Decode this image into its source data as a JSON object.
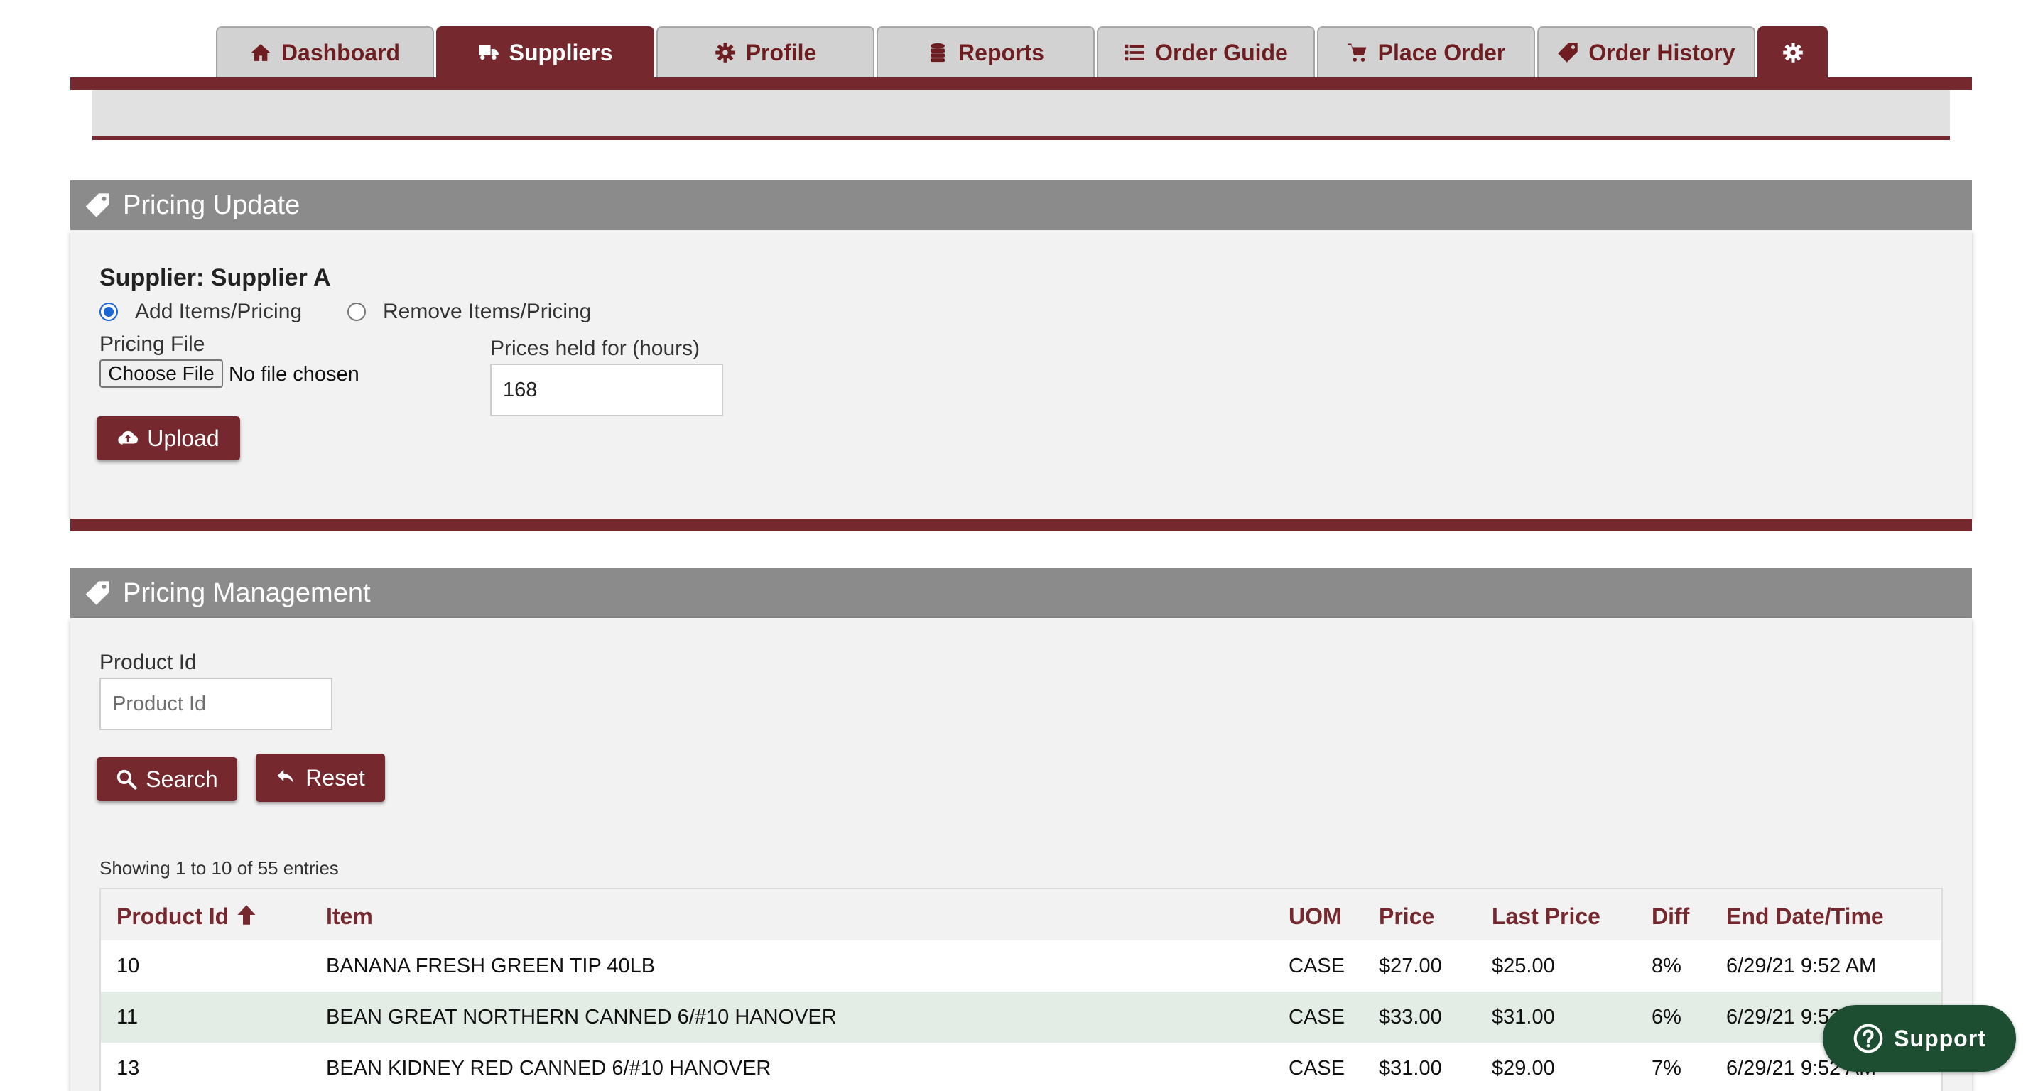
{
  "nav": {
    "tabs": [
      {
        "label": "Dashboard",
        "icon": "home-icon"
      },
      {
        "label": "Suppliers",
        "icon": "truck-icon",
        "active": true
      },
      {
        "label": "Profile",
        "icon": "gear-icon"
      },
      {
        "label": "Reports",
        "icon": "database-icon"
      },
      {
        "label": "Order Guide",
        "icon": "list-icon"
      },
      {
        "label": "Place Order",
        "icon": "cart-icon"
      },
      {
        "label": "Order History",
        "icon": "tag-icon"
      }
    ],
    "settings_icon": "gear-icon"
  },
  "pricing_update": {
    "title": "Pricing Update",
    "supplier_label": "Supplier: Supplier A",
    "radio_add": {
      "label": "Add Items/Pricing",
      "checked": true
    },
    "radio_remove": {
      "label": "Remove Items/Pricing",
      "checked": false
    },
    "file_label": "Pricing File",
    "file_button": "Choose File",
    "file_status": "No file chosen",
    "hours_label": "Prices held for (hours)",
    "hours_value": "168",
    "upload_button": "Upload"
  },
  "pricing_management": {
    "title": "Pricing Management",
    "product_id_label": "Product Id",
    "product_id_placeholder": "Product Id",
    "search_button": "Search",
    "reset_button": "Reset",
    "entries_info": "Showing 1 to 10 of 55 entries",
    "columns": [
      "Product Id",
      "Item",
      "UOM",
      "Price",
      "Last Price",
      "Diff",
      "End Date/Time"
    ],
    "rows": [
      {
        "product_id": "10",
        "item": "BANANA FRESH GREEN TIP 40LB",
        "uom": "CASE",
        "price": "$27.00",
        "last_price": "$25.00",
        "diff": "8%",
        "end": "6/29/21 9:52 AM"
      },
      {
        "product_id": "11",
        "item": "BEAN GREAT NORTHERN CANNED 6/#10 HANOVER",
        "uom": "CASE",
        "price": "$33.00",
        "last_price": "$31.00",
        "diff": "6%",
        "end": "6/29/21 9:52 AM"
      },
      {
        "product_id": "13",
        "item": "BEAN KIDNEY RED CANNED 6/#10 HANOVER",
        "uom": "CASE",
        "price": "$31.00",
        "last_price": "$29.00",
        "diff": "7%",
        "end": "6/29/21 9:52 AM"
      }
    ]
  },
  "support": {
    "label": "Support"
  },
  "colors": {
    "brand": "#75282d",
    "panel_header": "#8b8b8b",
    "support": "#1e4e31",
    "radio": "#1a66d6"
  }
}
